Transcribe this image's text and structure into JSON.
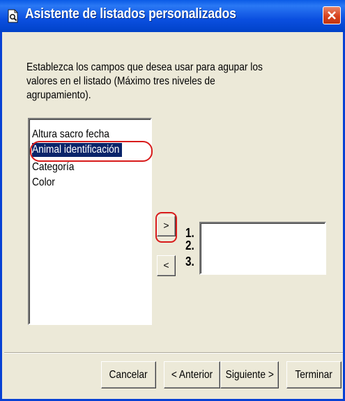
{
  "window": {
    "title": "Asistente de listados personalizados",
    "title_icon": "document-search-icon",
    "close_label": "X"
  },
  "instructions": "Establezca los campos que desea usar para agupar los valores en el listado (Máximo tres niveles de agrupamiento).",
  "fields_list": {
    "items": [
      {
        "label": "Altura sacro fecha"
      },
      {
        "label": "Animal identificación",
        "selected": true
      },
      {
        "label": "Categoría"
      },
      {
        "label": "Color"
      }
    ]
  },
  "move_buttons": {
    "add_label": ">",
    "remove_label": "<"
  },
  "levels": {
    "numbers": [
      "1.",
      "2.",
      "3."
    ],
    "values": []
  },
  "buttons": {
    "cancel": "Cancelar",
    "previous": "< Anterior",
    "next": "Siguiente >",
    "finish": "Terminar"
  },
  "colors": {
    "title_bar": "#0b4fe0",
    "dialog_background": "#ece9d8",
    "selection": "#0a246a",
    "annotation_circle": "#d81b1b",
    "close_button": "#d8421f"
  }
}
